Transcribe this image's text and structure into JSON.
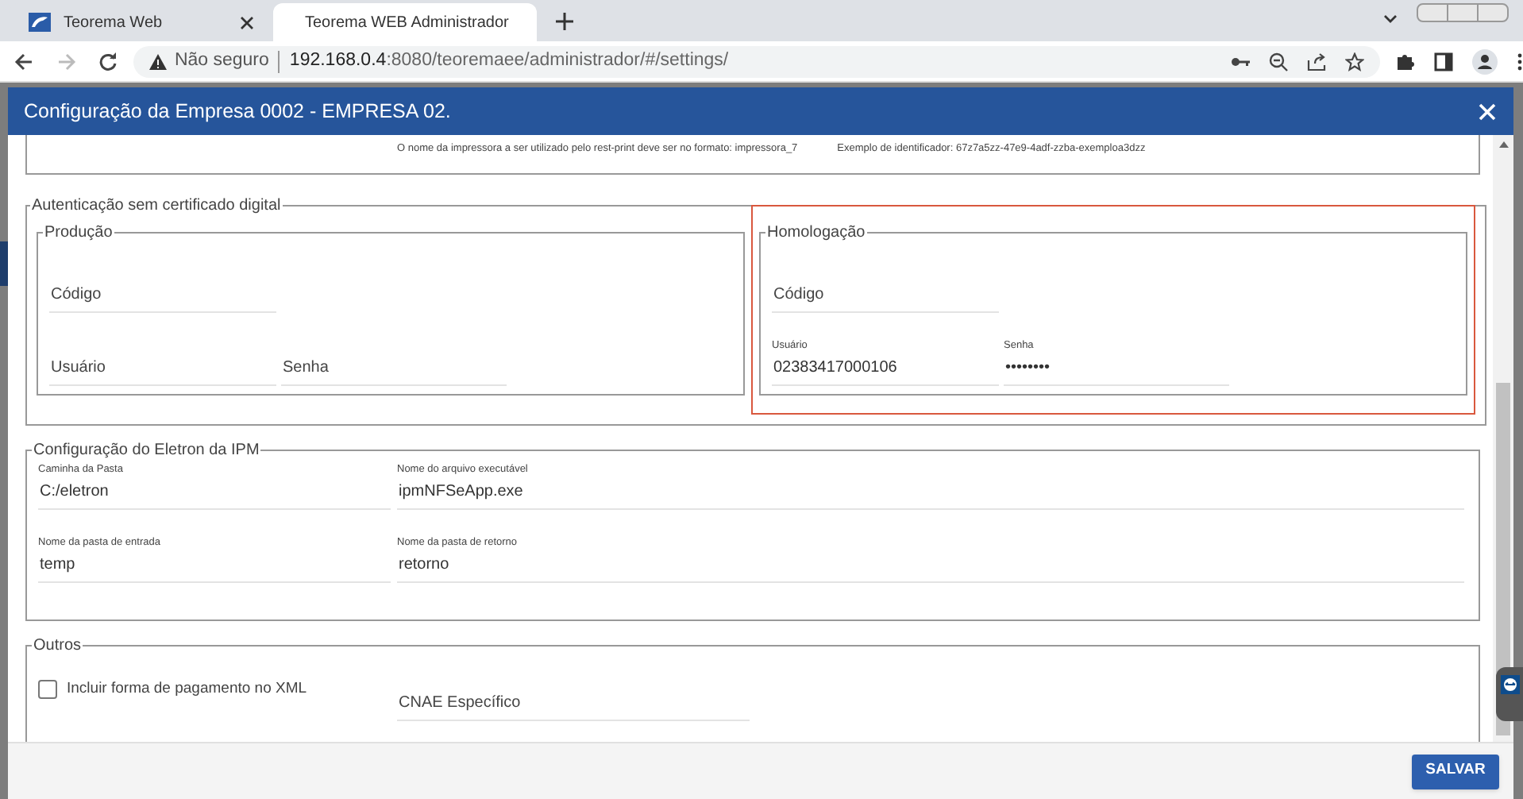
{
  "browser": {
    "tabs": [
      {
        "title": "Teorema Web",
        "selected": false
      },
      {
        "title": "Teorema WEB Administrador",
        "selected": true
      }
    ],
    "security": "Não seguro",
    "url_host": "192.168.0.4",
    "url_path": ":8080/teoremaee/administrador/#/settings/"
  },
  "modal": {
    "title": "Configuração da Empresa 0002 - EMPRESA 02.",
    "printer_hints": [
      "O nome da impressora a ser utilizado pelo rest-print deve ser no formato: impressora_7",
      "Exemplo de identificador: 67z7a5zz-47e9-4adf-zzba-exemploa3dzz"
    ],
    "auth": {
      "legend": "Autenticação sem certificado digital",
      "groups": [
        {
          "legend": "Produção",
          "highlighted": false,
          "fields": [
            {
              "label": "Código"
            },
            {
              "label": "Usuário"
            },
            {
              "label": "Senha"
            }
          ]
        },
        {
          "legend": "Homologação",
          "highlighted": true,
          "fields": [
            {
              "label": "Código"
            },
            {
              "label": "Usuário",
              "value": "02383417000106"
            },
            {
              "label": "Senha",
              "value": "••••••••"
            }
          ]
        }
      ]
    },
    "eletron": {
      "legend": "Configuração do Eletron da IPM",
      "fields": [
        {
          "label": "Caminha da Pasta",
          "value": "C:/eletron"
        },
        {
          "label": "Nome do arquivo executável",
          "value": "ipmNFSeApp.exe"
        },
        {
          "label": "Nome da pasta de entrada",
          "value": "temp"
        },
        {
          "label": "Nome da pasta de retorno",
          "value": "retorno"
        }
      ]
    },
    "outros": {
      "legend": "Outros",
      "checkbox": {
        "label": "Incluir forma de pagamento no XML",
        "checked": false
      },
      "field": {
        "label": "CNAE Específico"
      }
    },
    "save": "SALVAR"
  }
}
